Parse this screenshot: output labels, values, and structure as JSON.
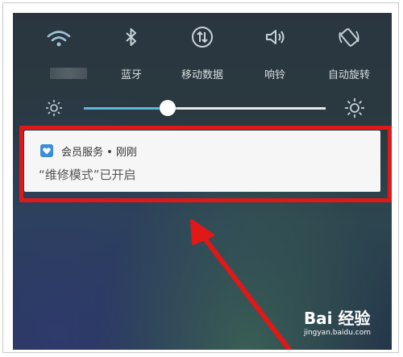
{
  "quick_settings": {
    "toggles": [
      {
        "label": "",
        "icon": "wifi-icon"
      },
      {
        "label": "蓝牙",
        "icon": "bluetooth-icon"
      },
      {
        "label": "移动数据",
        "icon": "mobile-data-icon"
      },
      {
        "label": "响铃",
        "icon": "volume-icon"
      },
      {
        "label": "自动旋转",
        "icon": "auto-rotate-icon"
      }
    ]
  },
  "brightness": {
    "level": 0.34,
    "low_icon": "brightness-low-icon",
    "high_icon": "brightness-high-icon"
  },
  "notification": {
    "app_name": "会员服务 • 刚刚",
    "message": "“维修模式”已开启",
    "icon": "member-service-icon"
  },
  "annotation": {
    "highlight_color": "#e01818"
  },
  "watermark": {
    "brand": "Bai 经验",
    "url": "jingyan.baidu.com"
  }
}
